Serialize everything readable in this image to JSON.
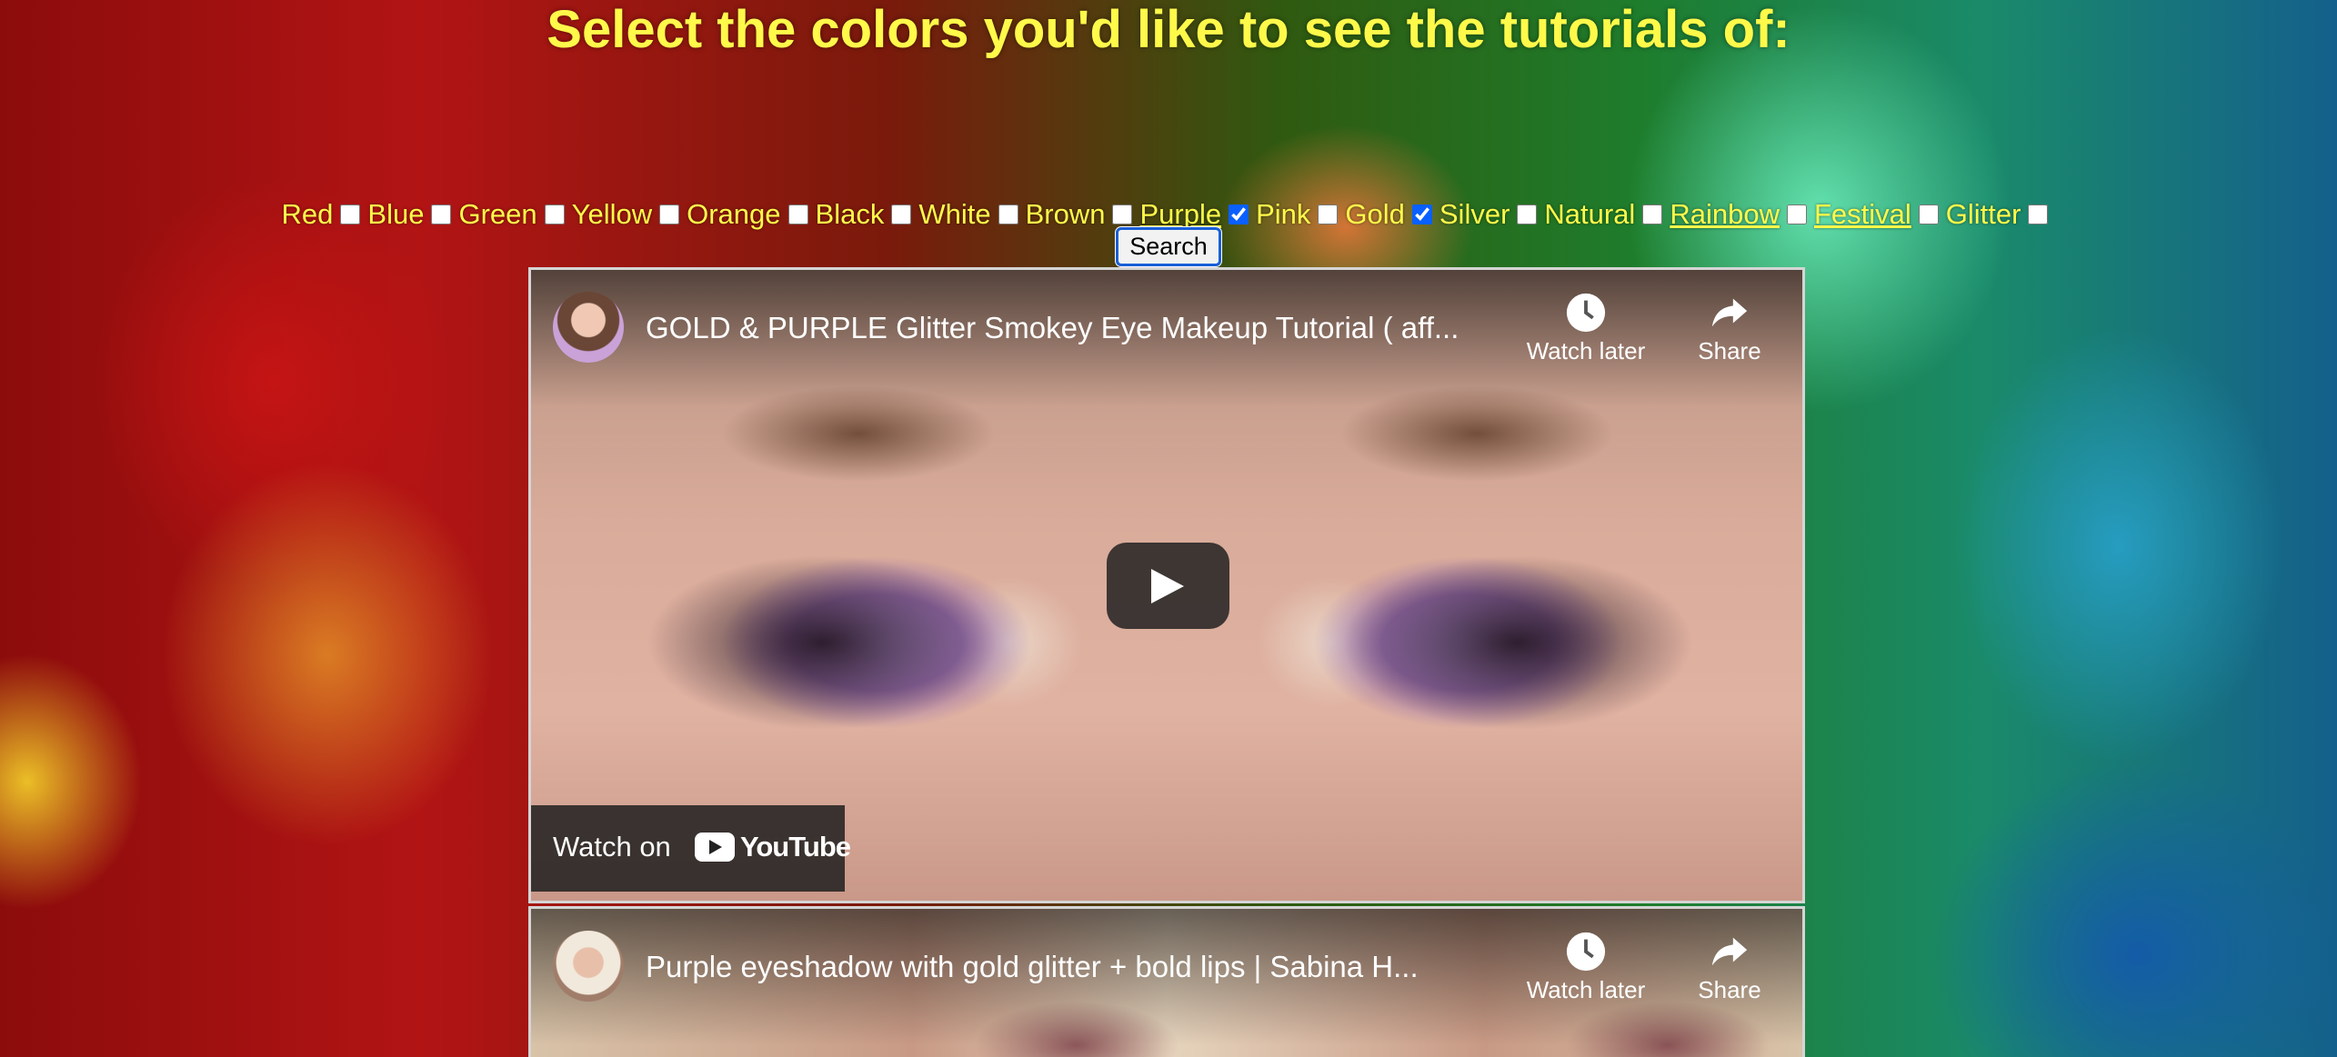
{
  "heading": "Select the colors you'd like to see the tutorials of:",
  "filters": [
    {
      "label": "Red",
      "checked": false,
      "underline": false
    },
    {
      "label": "Blue",
      "checked": false,
      "underline": false
    },
    {
      "label": "Green",
      "checked": false,
      "underline": false
    },
    {
      "label": "Yellow",
      "checked": false,
      "underline": false
    },
    {
      "label": "Orange",
      "checked": false,
      "underline": false
    },
    {
      "label": "Black",
      "checked": false,
      "underline": false
    },
    {
      "label": "White",
      "checked": false,
      "underline": false
    },
    {
      "label": "Brown",
      "checked": false,
      "underline": false
    },
    {
      "label": "Purple",
      "checked": true,
      "underline": true
    },
    {
      "label": "Pink",
      "checked": false,
      "underline": false
    },
    {
      "label": "Gold",
      "checked": true,
      "underline": false
    },
    {
      "label": "Silver",
      "checked": false,
      "underline": false
    },
    {
      "label": "Natural",
      "checked": false,
      "underline": false
    },
    {
      "label": "Rainbow",
      "checked": false,
      "underline": true
    },
    {
      "label": "Festival",
      "checked": false,
      "underline": true
    },
    {
      "label": "Glitter",
      "checked": false,
      "underline": false
    }
  ],
  "search_label": "Search",
  "videos": [
    {
      "title": "GOLD & PURPLE Glitter Smokey Eye Makeup Tutorial ( aff...",
      "watch_later": "Watch later",
      "share": "Share",
      "watch_on": "Watch on",
      "brand": "YouTube"
    },
    {
      "title": "Purple eyeshadow with gold glitter + bold lips | Sabina H...",
      "watch_later": "Watch later",
      "share": "Share"
    }
  ],
  "colors": {
    "heading": "#fff94a",
    "checkbox_accent": "#0a60ff",
    "search_border": "#1a5fd8"
  },
  "icons": {
    "watch_later": "clock-icon",
    "share": "share-arrow-icon",
    "play": "play-icon",
    "brand": "youtube-logo-icon"
  }
}
